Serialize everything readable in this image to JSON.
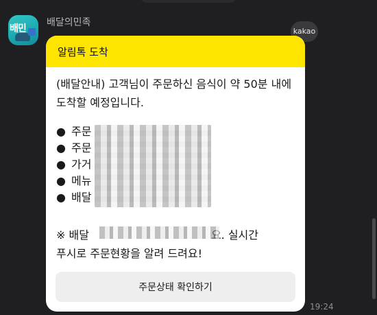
{
  "sender": {
    "name": "배달의민족",
    "avatar_icon": "baemin-app-icon"
  },
  "badge": {
    "label": "kakao"
  },
  "card": {
    "header_title": "알림톡 도착",
    "message": "(배달안내) 고객님이 주문하신 음식이 약 50분 내에 도착할 예정입니다.",
    "bullets": [
      {
        "marker": "●",
        "label": "주문"
      },
      {
        "marker": "●",
        "label": "주문"
      },
      {
        "marker": "●",
        "label": "가거"
      },
      {
        "marker": "●",
        "label": "메뉴"
      },
      {
        "marker": "●",
        "label": "배달"
      }
    ],
    "notice_line1_prefix": "※ 배달",
    "notice_line1_suffix": "요. 실시간",
    "notice_line2": "푸시로 주문현황을 알려 드려요!",
    "button_label": "주문상태 확인하기"
  },
  "timestamp": "19:24",
  "colors": {
    "header": "#fee500",
    "background": "#1f1f21",
    "card": "#ffffff"
  }
}
